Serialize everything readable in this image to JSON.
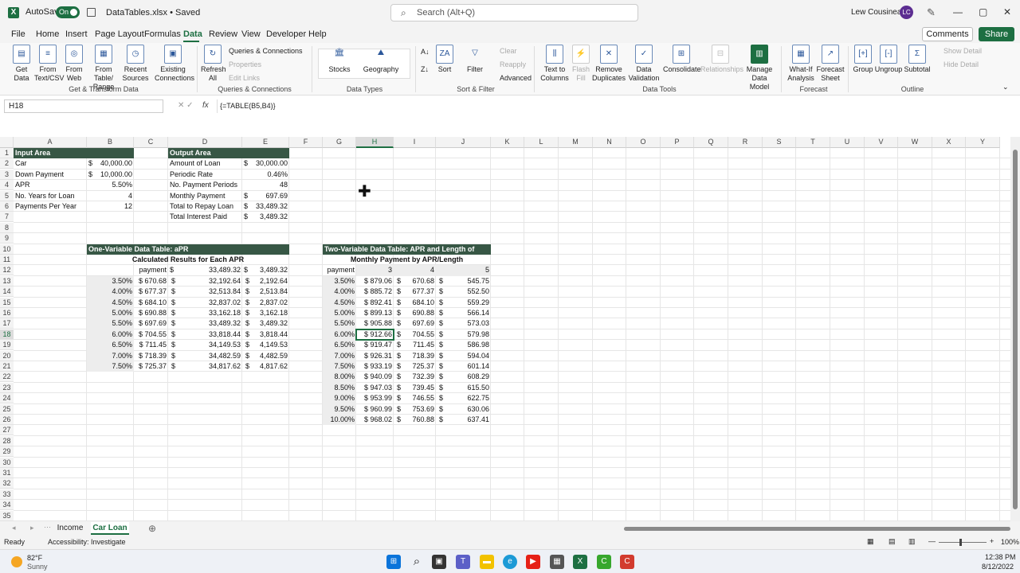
{
  "titlebar": {
    "autosave_label": "AutoSave",
    "autosave_state": "On",
    "doc_title": "DataTables.xlsx • Saved",
    "search_placeholder": "Search (Alt+Q)",
    "user_name": "Lew Cousineau",
    "user_initials": "LC"
  },
  "menu": {
    "items": [
      "File",
      "Home",
      "Insert",
      "Page Layout",
      "Formulas",
      "Data",
      "Review",
      "View",
      "Developer",
      "Help"
    ],
    "active": "Data",
    "comments": "Comments",
    "share": "Share"
  },
  "ribbon": {
    "get_data": "Get Data",
    "from_text": "From Text/CSV",
    "from_web": "From Web",
    "from_table": "From Table/ Range",
    "recent_sources": "Recent Sources",
    "existing_connections": "Existing Connections",
    "group_get_transform": "Get & Transform Data",
    "refresh_all": "Refresh All",
    "queries_connections": "Queries & Connections",
    "properties": "Properties",
    "edit_links": "Edit Links",
    "group_queries": "Queries & Connections",
    "stocks": "Stocks",
    "geography": "Geography",
    "group_data_types": "Data Types",
    "sort": "Sort",
    "filter": "Filter",
    "clear": "Clear",
    "reapply": "Reapply",
    "advanced": "Advanced",
    "group_sort_filter": "Sort & Filter",
    "text_to_columns": "Text to Columns",
    "flash_fill": "Flash Fill",
    "remove_duplicates": "Remove Duplicates",
    "data_validation": "Data Validation",
    "consolidate": "Consolidate",
    "relationships": "Relationships",
    "manage_data_model": "Manage Data Model",
    "group_data_tools": "Data Tools",
    "what_if": "What-If Analysis",
    "forecast_sheet": "Forecast Sheet",
    "group_forecast": "Forecast",
    "group": "Group",
    "ungroup": "Ungroup",
    "subtotal": "Subtotal",
    "show_detail": "Show Detail",
    "hide_detail": "Hide Detail",
    "group_outline": "Outline"
  },
  "formula_bar": {
    "name_box": "H18",
    "fx": "fx",
    "formula": "{=TABLE(B5,B4)}"
  },
  "columns": [
    "A",
    "B",
    "C",
    "D",
    "E",
    "F",
    "G",
    "H",
    "I",
    "J",
    "K",
    "L",
    "M",
    "N",
    "O",
    "P",
    "Q",
    "R",
    "S",
    "T",
    "U",
    "V",
    "W",
    "X",
    "Y"
  ],
  "rows": [
    "1",
    "2",
    "3",
    "4",
    "5",
    "6",
    "7",
    "8",
    "9",
    "10",
    "11",
    "12",
    "13",
    "14",
    "15",
    "16",
    "17",
    "18",
    "19",
    "20",
    "21",
    "22",
    "23",
    "24",
    "25",
    "26",
    "27",
    "28",
    "29",
    "30",
    "31",
    "32",
    "33",
    "34",
    "35"
  ],
  "input_area": {
    "title": "Input Area",
    "rows": [
      {
        "label": "Car",
        "cur": "$",
        "value": "40,000.00"
      },
      {
        "label": "Down Payment",
        "cur": "$",
        "value": "10,000.00"
      },
      {
        "label": "APR",
        "cur": "",
        "value": "5.50%"
      },
      {
        "label": "No. Years for Loan",
        "cur": "",
        "value": "4"
      },
      {
        "label": "Payments Per Year",
        "cur": "",
        "value": "12"
      }
    ]
  },
  "output_area": {
    "title": "Output Area",
    "rows": [
      {
        "label": "Amount of Loan",
        "cur": "$",
        "value": "30,000.00"
      },
      {
        "label": "Periodic Rate",
        "cur": "",
        "value": "0.46%"
      },
      {
        "label": "No. Payment Periods",
        "cur": "",
        "value": "48"
      },
      {
        "label": "Monthly Payment",
        "cur": "$",
        "value": "697.69"
      },
      {
        "label": "Total to Repay Loan",
        "cur": "$",
        "value": "33,489.32"
      },
      {
        "label": "Total Interest Paid",
        "cur": "$",
        "value": "3,489.32"
      }
    ]
  },
  "one_var": {
    "title": "One-Variable Data Table: aPR",
    "subtitle": "Calculated Results for Each APR",
    "hdr_payment": "payment",
    "hdr_cur1": "$",
    "hdr_total": "33,489.32",
    "hdr_cur2": "$",
    "hdr_interest": "3,489.32",
    "rows": [
      {
        "apr": "3.50%",
        "pay": "$ 670.68",
        "total": "32,192.64",
        "interest": "2,192.64"
      },
      {
        "apr": "4.00%",
        "pay": "$ 677.37",
        "total": "32,513.84",
        "interest": "2,513.84"
      },
      {
        "apr": "4.50%",
        "pay": "$ 684.10",
        "total": "32,837.02",
        "interest": "2,837.02"
      },
      {
        "apr": "5.00%",
        "pay": "$ 690.88",
        "total": "33,162.18",
        "interest": "3,162.18"
      },
      {
        "apr": "5.50%",
        "pay": "$ 697.69",
        "total": "33,489.32",
        "interest": "3,489.32"
      },
      {
        "apr": "6.00%",
        "pay": "$ 704.55",
        "total": "33,818.44",
        "interest": "3,818.44"
      },
      {
        "apr": "6.50%",
        "pay": "$ 711.45",
        "total": "34,149.53",
        "interest": "4,149.53"
      },
      {
        "apr": "7.00%",
        "pay": "$ 718.39",
        "total": "34,482.59",
        "interest": "4,482.59"
      },
      {
        "apr": "7.50%",
        "pay": "$ 725.37",
        "total": "34,817.62",
        "interest": "4,817.62"
      }
    ]
  },
  "two_var": {
    "title": "Two-Variable Data Table: APR and Length of Loan",
    "subtitle": "Monthly Payment by APR/Length",
    "hdr_payment": "payment",
    "years": [
      "3",
      "4",
      "5"
    ],
    "rows": [
      {
        "apr": "3.50%",
        "y3": "$ 879.06",
        "y4": "670.68",
        "y5": "545.75"
      },
      {
        "apr": "4.00%",
        "y3": "$ 885.72",
        "y4": "677.37",
        "y5": "552.50"
      },
      {
        "apr": "4.50%",
        "y3": "$ 892.41",
        "y4": "684.10",
        "y5": "559.29"
      },
      {
        "apr": "5.00%",
        "y3": "$ 899.13",
        "y4": "690.88",
        "y5": "566.14"
      },
      {
        "apr": "5.50%",
        "y3": "$ 905.88",
        "y4": "697.69",
        "y5": "573.03"
      },
      {
        "apr": "6.00%",
        "y3": "$ 912.66",
        "y4": "704.55",
        "y5": "579.98"
      },
      {
        "apr": "6.50%",
        "y3": "$ 919.47",
        "y4": "711.45",
        "y5": "586.98"
      },
      {
        "apr": "7.00%",
        "y3": "$ 926.31",
        "y4": "718.39",
        "y5": "594.04"
      },
      {
        "apr": "7.50%",
        "y3": "$ 933.19",
        "y4": "725.37",
        "y5": "601.14"
      },
      {
        "apr": "8.00%",
        "y3": "$ 940.09",
        "y4": "732.39",
        "y5": "608.29"
      },
      {
        "apr": "8.50%",
        "y3": "$ 947.03",
        "y4": "739.45",
        "y5": "615.50"
      },
      {
        "apr": "9.00%",
        "y3": "$ 953.99",
        "y4": "746.55",
        "y5": "622.75"
      },
      {
        "apr": "9.50%",
        "y3": "$ 960.99",
        "y4": "753.69",
        "y5": "630.06"
      },
      {
        "apr": "10.00%",
        "y3": "$ 968.02",
        "y4": "760.88",
        "y5": "637.41"
      }
    ]
  },
  "sheets": {
    "tabs": [
      "Income",
      "Car Loan"
    ],
    "active": "Car Loan"
  },
  "status": {
    "ready": "Ready",
    "accessibility": "Accessibility: Investigate",
    "zoom": "100%"
  },
  "taskbar": {
    "temp": "82°F",
    "weather": "Sunny",
    "time": "12:38 PM",
    "date": "8/12/2022"
  }
}
